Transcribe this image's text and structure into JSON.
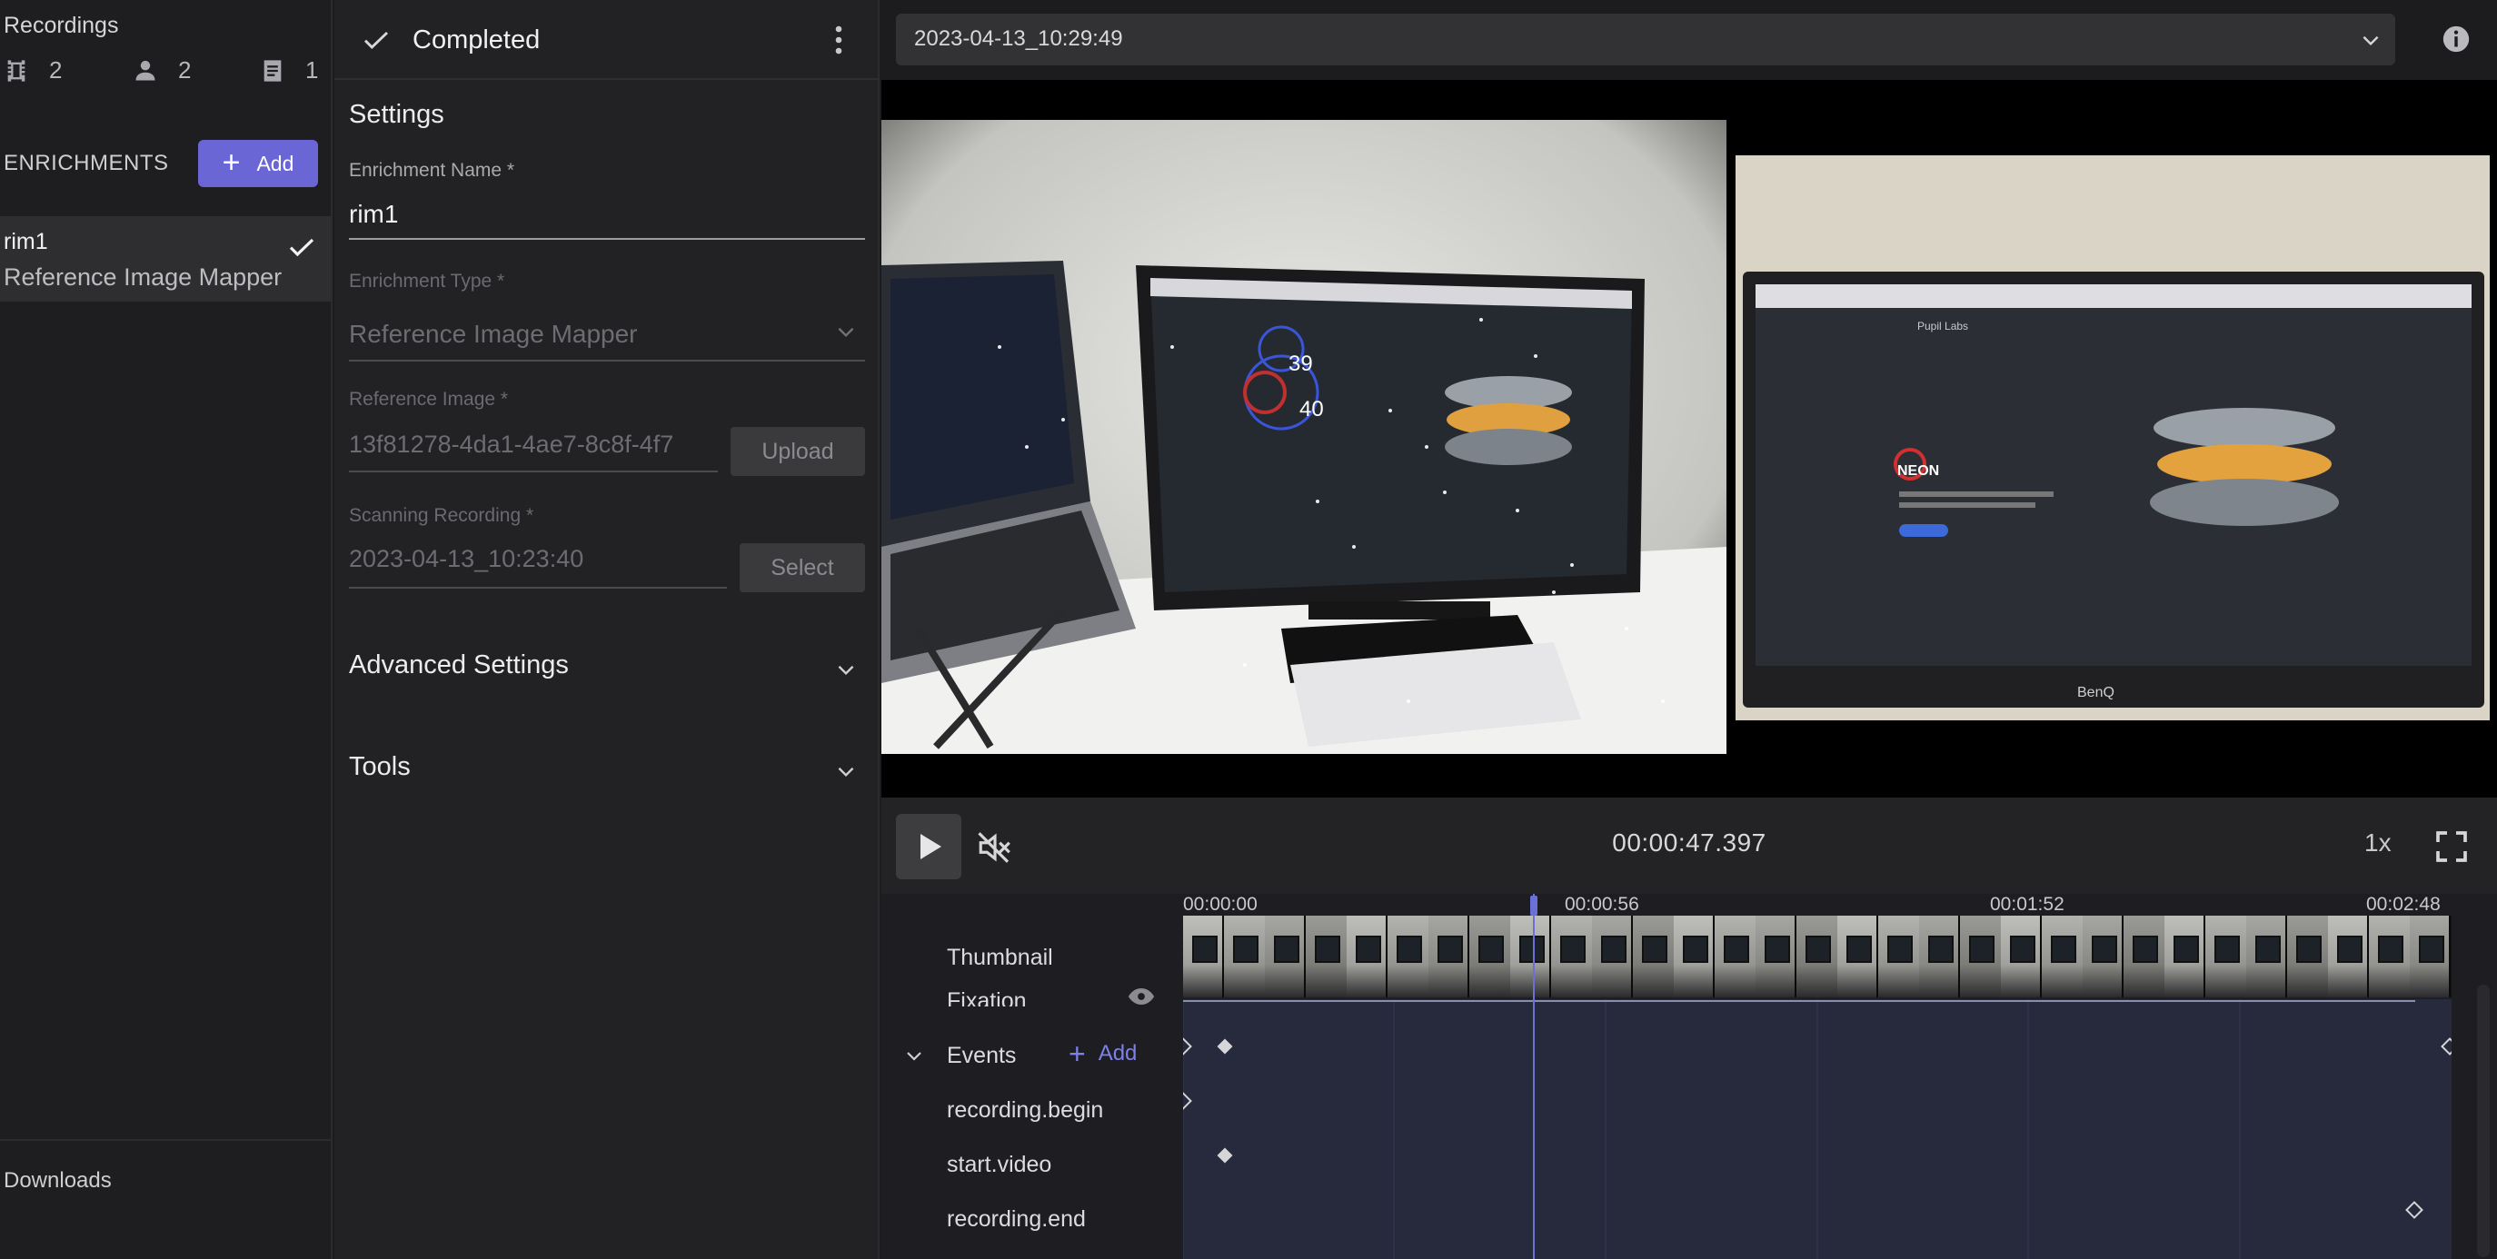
{
  "sidebar": {
    "title": "Recordings",
    "stats": [
      {
        "icon": "film-icon",
        "value": "2"
      },
      {
        "icon": "person-icon",
        "value": "2"
      },
      {
        "icon": "document-icon",
        "value": "1"
      }
    ],
    "enrichments_label": "ENRICHMENTS",
    "add_label": "Add",
    "enrichment": {
      "name": "rim1",
      "type": "Reference Image Mapper"
    },
    "downloads_label": "Downloads"
  },
  "settings": {
    "status": "Completed",
    "section_title": "Settings",
    "fields": {
      "name": {
        "label": "Enrichment Name *",
        "value": "rim1"
      },
      "type": {
        "label": "Enrichment Type *",
        "value": "Reference Image Mapper"
      },
      "reference_image": {
        "label": "Reference Image *",
        "value": "13f81278-4da1-4ae7-8c8f-4f7",
        "button": "Upload"
      },
      "scanning_recording": {
        "label": "Scanning Recording *",
        "value": "2023-04-13_10:23:40",
        "button": "Select"
      }
    },
    "advanced_label": "Advanced Settings",
    "tools_label": "Tools"
  },
  "main": {
    "recording": "2023-04-13_10:29:49",
    "fixation_numbers": [
      "39",
      "40"
    ],
    "ref_brand": "NEON",
    "ref_monitor_brand": "BenQ",
    "ref_site_brand": "Pupil Labs",
    "player": {
      "time": "00:00:47.397",
      "speed": "1x",
      "progress": 0.28
    },
    "timeline": {
      "ticks": [
        "00:00:00",
        "00:00:56",
        "00:01:52",
        "00:02:48"
      ],
      "rows": {
        "thumbnail": "Thumbnail",
        "fixation": "Fixation",
        "events": "Events",
        "events_add": "Add",
        "recording_begin": "recording.begin",
        "start_video": "start.video",
        "recording_end": "recording.end"
      }
    }
  },
  "colors": {
    "accent": "#6a66d6",
    "track_bg": "#262a3c",
    "playhead": "#6b70d6"
  }
}
